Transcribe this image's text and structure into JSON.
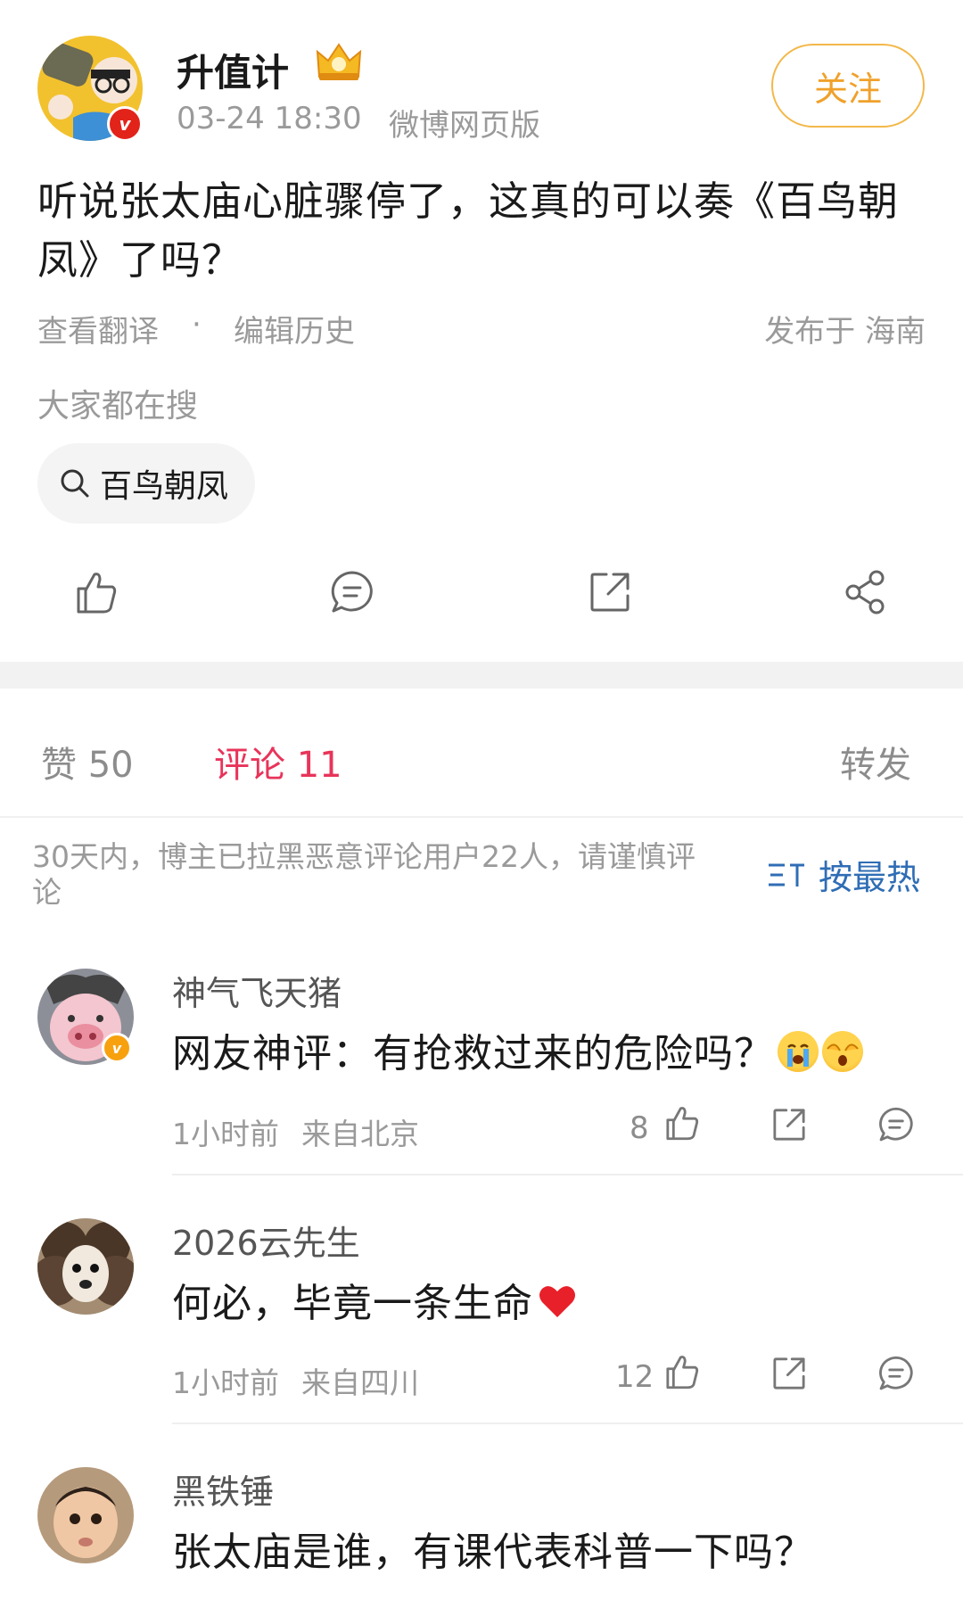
{
  "post": {
    "author": "升值计",
    "time": "03-24 18:30",
    "source": "微博网页版",
    "follow_label": "关注",
    "text": "听说张太庙心脏骤停了，这真的可以奏《百鸟朝凤》了吗？",
    "translate_label": "查看翻译",
    "dot": "·",
    "edit_history_label": "编辑历史",
    "location": "发布于 海南",
    "search_heading": "大家都在搜",
    "search_chip": "百鸟朝凤"
  },
  "tabs": {
    "likes": "赞 50",
    "comments": "评论 11",
    "reposts": "转发"
  },
  "notice": "30天内，博主已拉黑恶意评论用户22人，请谨慎评论",
  "sort_label": "按最热",
  "comments": [
    {
      "name": "神气飞天猪",
      "text": "网友神评：有抢救过来的危险吗？",
      "time": "1小时前",
      "from": "来自北京",
      "likes": "8",
      "emojis": [
        "crying-face",
        "shocked-face"
      ]
    },
    {
      "name": "2026云先生",
      "text": "何必，毕竟一条生命",
      "time": "1小时前",
      "from": "来自四川",
      "likes": "12",
      "emojis": [
        "red-heart"
      ]
    },
    {
      "name": "黑铁锤",
      "text": "张太庙是谁，有课代表科普一下吗？"
    }
  ],
  "colors": {
    "accent": "#e8345a",
    "follow": "#f0a12b",
    "link": "#2f6db5"
  }
}
